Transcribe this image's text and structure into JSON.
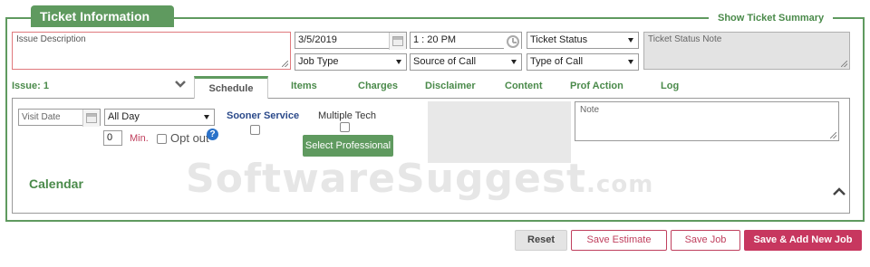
{
  "header": {
    "title": "Ticket Information",
    "summary_link": "Show Ticket Summary"
  },
  "form": {
    "issue_description_placeholder": "Issue Description",
    "date": "3/5/2019",
    "time": "1 : 20  PM",
    "ticket_status": "Ticket Status",
    "ticket_status_note_placeholder": "Ticket Status Note",
    "job_type": "Job Type",
    "source_of_call": "Source of Call",
    "type_of_call": "Type of Call"
  },
  "tabs": {
    "issue_label": "Issue: 1",
    "items": [
      "Schedule",
      "Items",
      "Charges",
      "Disclaimer",
      "Content",
      "Prof Action",
      "Log"
    ],
    "active": "Schedule"
  },
  "schedule": {
    "visit_date_placeholder": "Visit Date",
    "time_window": "All Day",
    "minutes_value": "0",
    "minutes_label": "Min.",
    "opt_out_label": "Opt out",
    "help_icon_text": "?",
    "sooner_service_label": "Sooner Service",
    "multiple_tech_label": "Multiple Tech",
    "select_professional": "Select Professional",
    "note_placeholder": "Note"
  },
  "calendar": {
    "label": "Calendar"
  },
  "watermark": {
    "main": "SoftwareSuggest",
    "suffix": ".com"
  },
  "actions": {
    "reset": "Reset",
    "save_estimate": "Save Estimate",
    "save_job": "Save Job",
    "save_add_new": "Save & Add New Job"
  },
  "colors": {
    "accent_green": "#5f9a5f",
    "primary_pink": "#c7375f",
    "help_blue": "#2b72c9",
    "sooner_blue": "#2b4a8a"
  },
  "icons": [
    "calendar-icon",
    "clock-icon",
    "chevron-down-icon",
    "chevron-up-icon",
    "help-icon"
  ]
}
